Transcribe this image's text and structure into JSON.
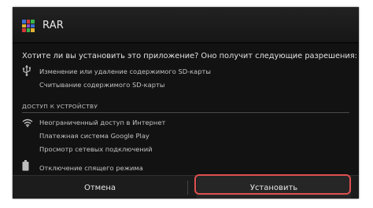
{
  "dialog": {
    "title": "RAR",
    "app_icon": "rar-app-icon",
    "question": "Хотите ли вы установить это приложение? Оно получит следующие разрешения:"
  },
  "storage_permissions": {
    "icon": "usb-icon",
    "items": [
      "Изменение или удаление содержимого SD-карты",
      "Считывание содержимого SD-карты"
    ]
  },
  "device_access": {
    "header": "ДОСТУП К УСТРОЙСТВУ",
    "network": {
      "icon": "wifi-icon",
      "items": [
        "Неограниченный доступ в Интернет",
        "Платежная система Google Play",
        "Просмотр сетевых подключений"
      ]
    },
    "power": {
      "icon": "battery-icon",
      "items": [
        "Отключение спящего режима"
      ]
    }
  },
  "buttons": {
    "cancel": "Отмена",
    "install": "Установить"
  },
  "colors": {
    "screen_background": "#121212",
    "highlight_border": "#e0504f",
    "text_primary": "#e2e2e2",
    "text_secondary": "#c4c4c4"
  }
}
